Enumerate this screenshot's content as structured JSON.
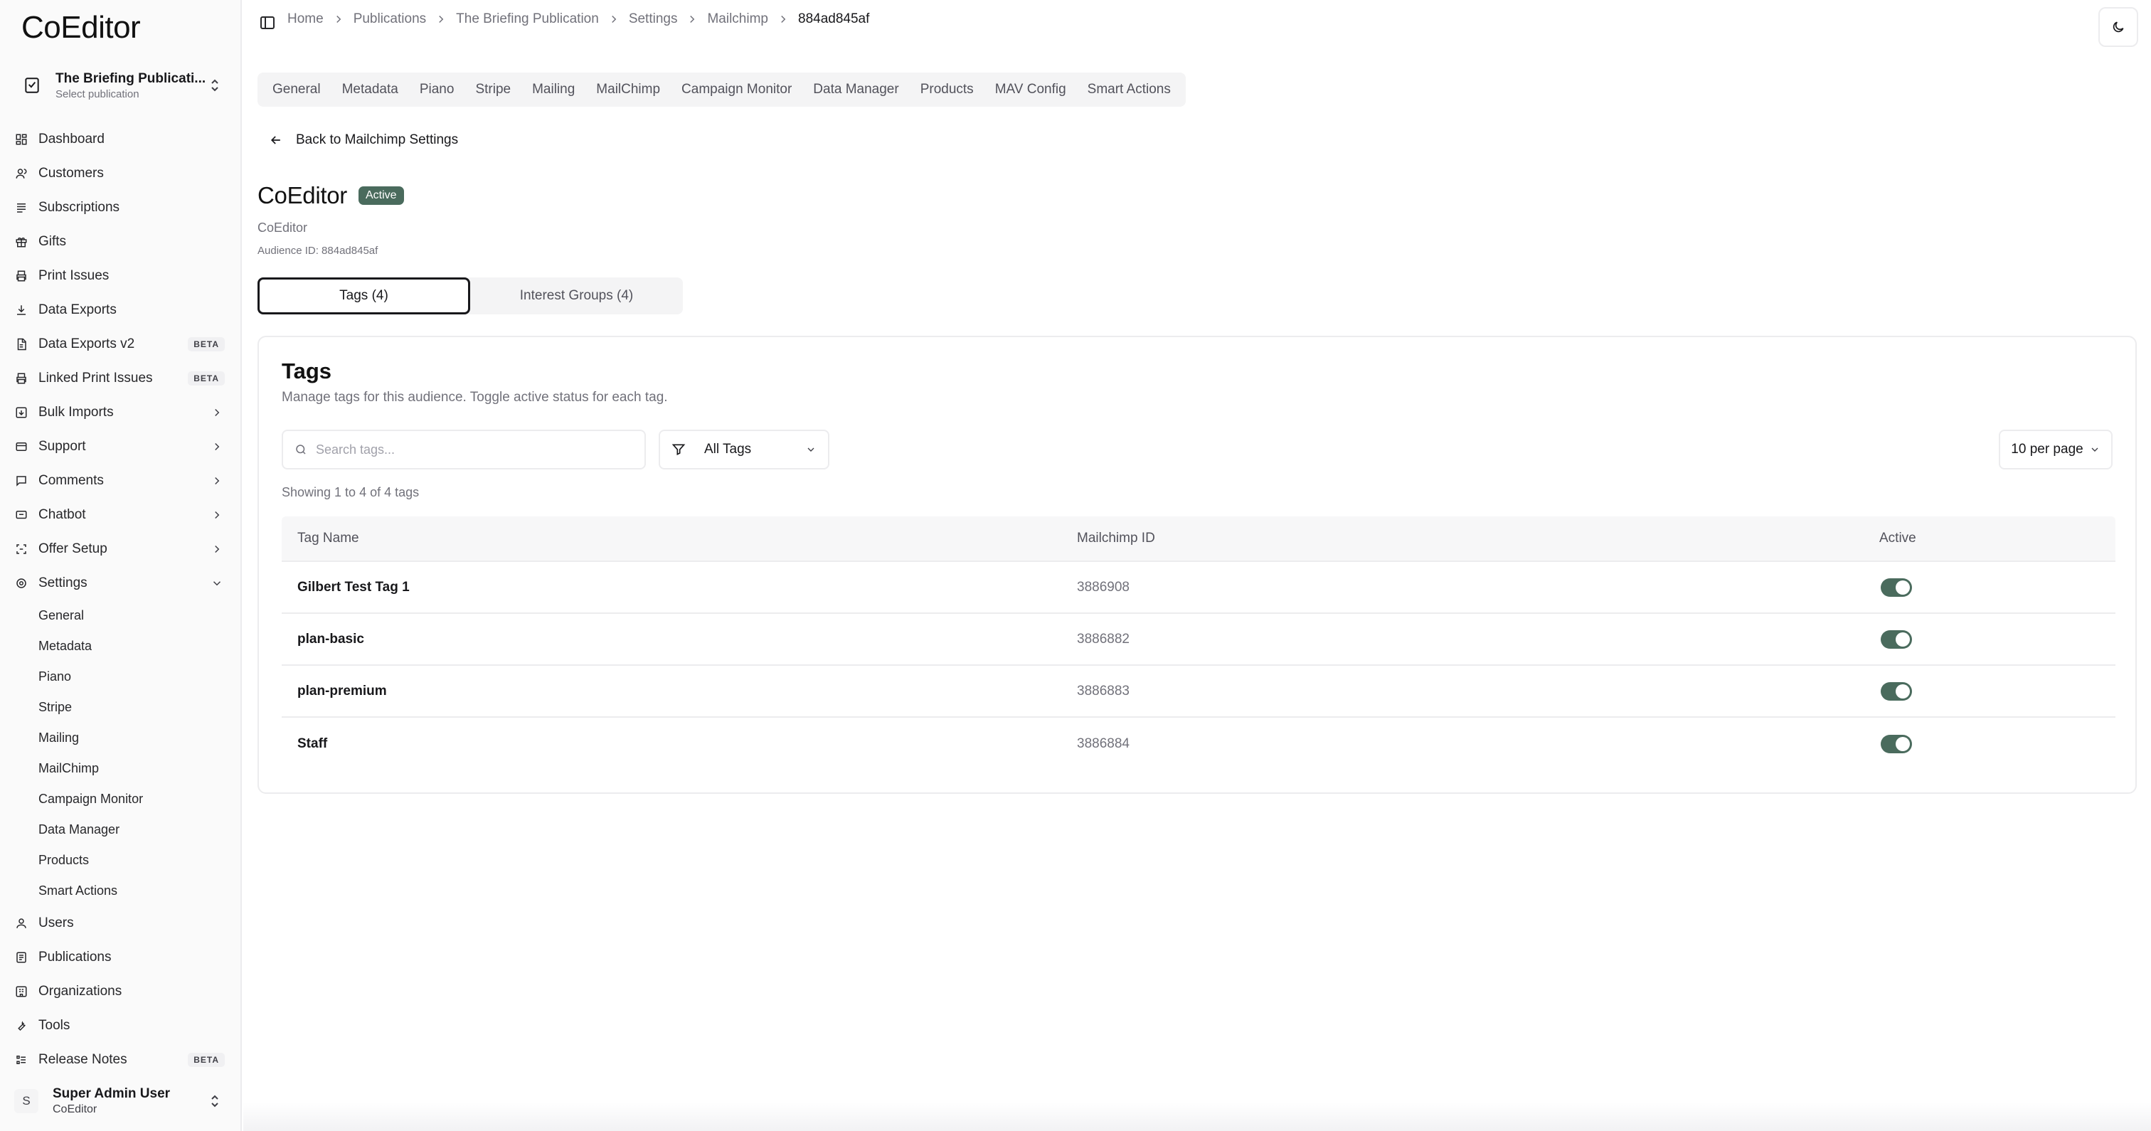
{
  "app": {
    "brand": "CoEditor"
  },
  "publication": {
    "name": "The Briefing Publicati...",
    "hint": "Select publication"
  },
  "nav": [
    {
      "icon": "dashboard-icon",
      "label": "Dashboard"
    },
    {
      "icon": "customers-icon",
      "label": "Customers"
    },
    {
      "icon": "subscriptions-icon",
      "label": "Subscriptions"
    },
    {
      "icon": "gift-icon",
      "label": "Gifts"
    },
    {
      "icon": "printer-icon",
      "label": "Print Issues"
    },
    {
      "icon": "download-icon",
      "label": "Data Exports"
    },
    {
      "icon": "file-icon",
      "label": "Data Exports v2",
      "badge": "BETA"
    },
    {
      "icon": "printer-icon",
      "label": "Linked Print Issues",
      "badge": "BETA"
    },
    {
      "icon": "import-icon",
      "label": "Bulk Imports",
      "expandable": true
    },
    {
      "icon": "support-icon",
      "label": "Support",
      "expandable": true
    },
    {
      "icon": "comment-icon",
      "label": "Comments",
      "expandable": true
    },
    {
      "icon": "chatbot-icon",
      "label": "Chatbot",
      "expandable": true
    },
    {
      "icon": "offer-icon",
      "label": "Offer Setup",
      "expandable": true
    },
    {
      "icon": "settings-icon",
      "label": "Settings",
      "expanded": true
    }
  ],
  "settings_sub": [
    "General",
    "Metadata",
    "Piano",
    "Stripe",
    "Mailing",
    "MailChimp",
    "Campaign Monitor",
    "Data Manager",
    "Products",
    "Smart Actions"
  ],
  "nav_bottom": [
    {
      "icon": "user-icon",
      "label": "Users"
    },
    {
      "icon": "publications-icon",
      "label": "Publications"
    },
    {
      "icon": "organization-icon",
      "label": "Organizations"
    },
    {
      "icon": "wrench-icon",
      "label": "Tools"
    },
    {
      "icon": "release-notes-icon",
      "label": "Release Notes",
      "badge": "BETA"
    }
  ],
  "user": {
    "initial": "S",
    "name": "Super Admin User",
    "org": "CoEditor"
  },
  "breadcrumbs": [
    "Home",
    "Publications",
    "The Briefing Publication",
    "Settings",
    "Mailchimp",
    "884ad845af"
  ],
  "settings_tabs": [
    "General",
    "Metadata",
    "Piano",
    "Stripe",
    "Mailing",
    "MailChimp",
    "Campaign Monitor",
    "Data Manager",
    "Products",
    "MAV Config",
    "Smart Actions"
  ],
  "back_label": "Back to Mailchimp Settings",
  "audience": {
    "title": "CoEditor",
    "status": "Active",
    "subtitle": "CoEditor",
    "id_label": "Audience ID: 884ad845af"
  },
  "segments": {
    "tags": "Tags (4)",
    "interest": "Interest Groups (4)",
    "active": "tags"
  },
  "tags_card": {
    "title": "Tags",
    "description": "Manage tags for this audience. Toggle active status for each tag.",
    "search_placeholder": "Search tags...",
    "filter_value": "All Tags",
    "per_page": "10 per page",
    "showing": "Showing 1 to 4 of 4 tags",
    "columns": [
      "Tag Name",
      "Mailchimp ID",
      "Active"
    ],
    "rows": [
      {
        "name": "Gilbert Test Tag 1",
        "id": "3886908",
        "active": true
      },
      {
        "name": "plan-basic",
        "id": "3886882",
        "active": true
      },
      {
        "name": "plan-premium",
        "id": "3886883",
        "active": true
      },
      {
        "name": "Staff",
        "id": "3886884",
        "active": true
      }
    ]
  },
  "colors": {
    "accent": "#4a6b5d",
    "border": "#ececee",
    "muted": "#71717a"
  }
}
